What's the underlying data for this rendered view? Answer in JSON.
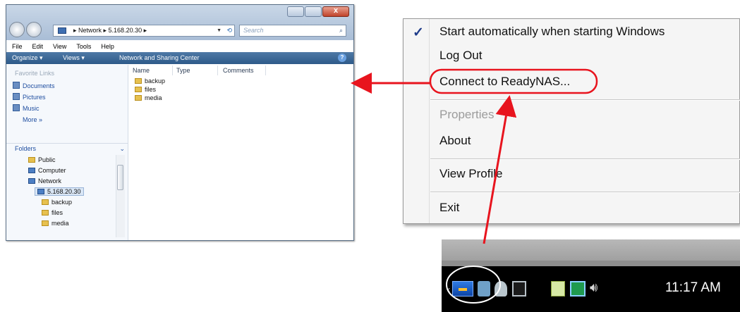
{
  "explorer": {
    "address": {
      "crumbs": "▸ Network ▸ 5.168.20.30 ▸"
    },
    "search": {
      "placeholder": "Search"
    },
    "menu": [
      "File",
      "Edit",
      "View",
      "Tools",
      "Help"
    ],
    "commands": {
      "organize": "Organize ▾",
      "views": "Views ▾",
      "network_center": "Network and Sharing Center",
      "help": "?"
    },
    "favorite_links": {
      "header": "Favorite Links",
      "items": [
        "Documents",
        "Pictures",
        "Music"
      ],
      "more": "More »"
    },
    "folders": {
      "header": "Folders",
      "tree": [
        "Public",
        "Computer",
        "Network",
        "5.168.20.30",
        "backup",
        "files",
        "media"
      ]
    },
    "columns": [
      "Name",
      "Type",
      "Comments"
    ],
    "files": [
      "backup",
      "files",
      "media"
    ]
  },
  "context_menu": {
    "items": [
      {
        "label": "Start automatically when starting Windows",
        "checked": true
      },
      {
        "label": "Log Out"
      },
      {
        "label": "Connect to ReadyNAS..."
      },
      {
        "label": "Properties",
        "disabled": true
      },
      {
        "label": "About"
      },
      {
        "label": "View Profile"
      },
      {
        "label": "Exit"
      }
    ],
    "check_glyph": "✓"
  },
  "taskbar": {
    "clock": "11:17 AM",
    "icons": [
      "readynas-icon",
      "network-icon",
      "satellite-icon",
      "monitor-icon",
      "power-icon",
      "connection-icon",
      "speaker-icon"
    ]
  },
  "colors": {
    "callout": "#e8141e",
    "explorer_cmdbar": "#3a6797",
    "menu_check": "#1f3c8a"
  }
}
